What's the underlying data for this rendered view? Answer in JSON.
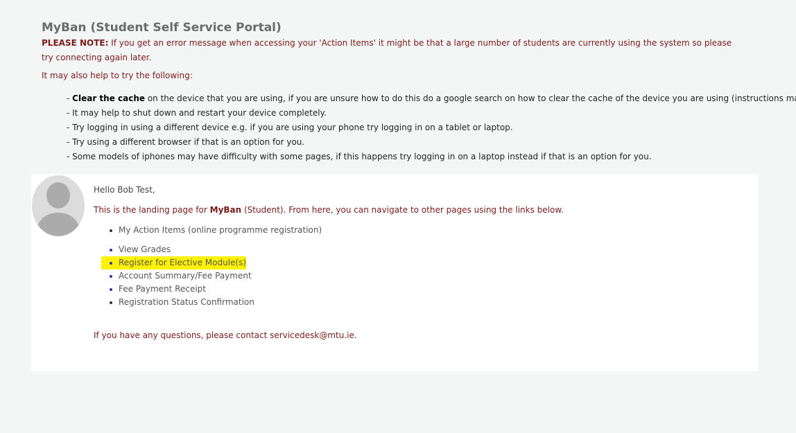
{
  "page": {
    "title": "MyBan (Student Self Service Portal)",
    "note_label": "PLEASE NOTE:",
    "note_text": " If you get an error message when accessing your 'Action Items' it might be that a large number of students are currently using the system so please try connecting again later.",
    "also_help": "It may also help to try the following:"
  },
  "tips": [
    {
      "prefix": "- ",
      "bold": "Clear the cache",
      "text": " on the device that you are using, if you are unsure how to do this do a google search on how to clear the cache of the device you are using (instructions may va"
    },
    {
      "text": "- It may help to shut down and restart your device completely."
    },
    {
      "text": "- Try logging in using a different device e.g. if you are using your phone try logging in on a tablet or laptop."
    },
    {
      "text": "- Try using a different browser if that is an option for you."
    },
    {
      "text": "- Some models of iphones may have difficulty with some pages, if this happens try logging in on a laptop instead if that is an option for you."
    }
  ],
  "panel": {
    "greeting": "Hello Bob Test,",
    "landing_before": "This is the landing page for ",
    "landing_brand": "MyBan",
    "landing_after": " (Student). From here, you can navigate to other pages using the links below.",
    "action_items": "My Action Items (online programme registration)",
    "links": [
      {
        "label": "View Grades"
      },
      {
        "label": "Register for Elective Module(s)"
      },
      {
        "label": "Account Summary/Fee Payment"
      },
      {
        "label": "Fee Payment Receipt"
      },
      {
        "label": "Registration Status Confirmation"
      }
    ],
    "contact": "If you have any questions, please contact servicedesk@mtu.ie."
  },
  "colors": {
    "page_background": "#f4f5f5",
    "panel_background": "#ffffff",
    "title": "#6b6b6b",
    "note_text": "#7a1a1a",
    "link_bullet": "#2b2bb8",
    "highlight": "#fff200"
  },
  "icons": {
    "avatar": "user-silhouette-icon"
  }
}
